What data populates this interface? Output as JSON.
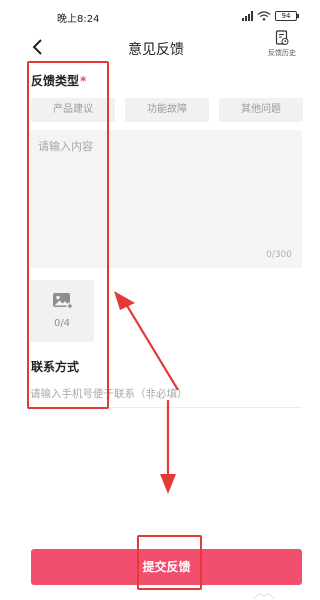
{
  "status_bar": {
    "time": "晚上8:24",
    "battery": "94"
  },
  "header": {
    "back_icon": "chevron-left-icon",
    "title": "意见反馈",
    "history_label": "反馈历史",
    "history_icon": "document-clock-icon"
  },
  "feedback_type": {
    "label": "反馈类型",
    "required_mark": "*",
    "options": [
      "产品建议",
      "功能故障",
      "其他问题"
    ]
  },
  "content": {
    "placeholder": "请输入内容",
    "counter": "0/300"
  },
  "image_upload": {
    "icon": "image-add-icon",
    "count": "0/4"
  },
  "contact": {
    "label": "联系方式",
    "placeholder": "请输入手机号便于联系（非必填）"
  },
  "submit": {
    "label": "提交反馈"
  },
  "colors": {
    "accent": "#f14f6d",
    "annotation": "#e53935",
    "required": "#e8455a"
  }
}
